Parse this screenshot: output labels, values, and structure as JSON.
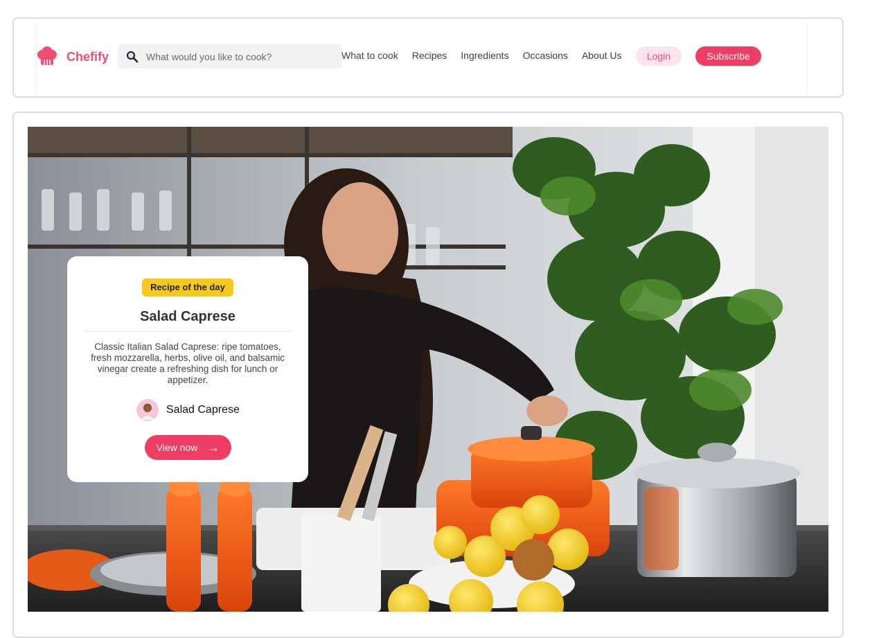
{
  "brand": {
    "name": "Chefify",
    "logo_icon": "chef-hat-icon",
    "accent_color": "#f04e73"
  },
  "search": {
    "placeholder": "What would you like to cook?",
    "value": "",
    "icon": "search-icon"
  },
  "nav": {
    "links": [
      "What to cook",
      "Recipes",
      "Ingredients",
      "Occasions",
      "About Us"
    ],
    "login_label": "Login",
    "subscribe_label": "Subscribe"
  },
  "hero": {
    "badge": "Recipe of the day",
    "title": "Salad Caprese",
    "description": "Classic Italian Salad Caprese: ripe tomatoes, fresh mozzarella, herbs, olive oil, and balsamic vinegar create a refreshing dish for lunch or appetizer.",
    "author_name": "Salad Caprese",
    "button_label": "View now",
    "button_icon": "arrow-right-icon",
    "badge_color": "#f8c91a"
  }
}
